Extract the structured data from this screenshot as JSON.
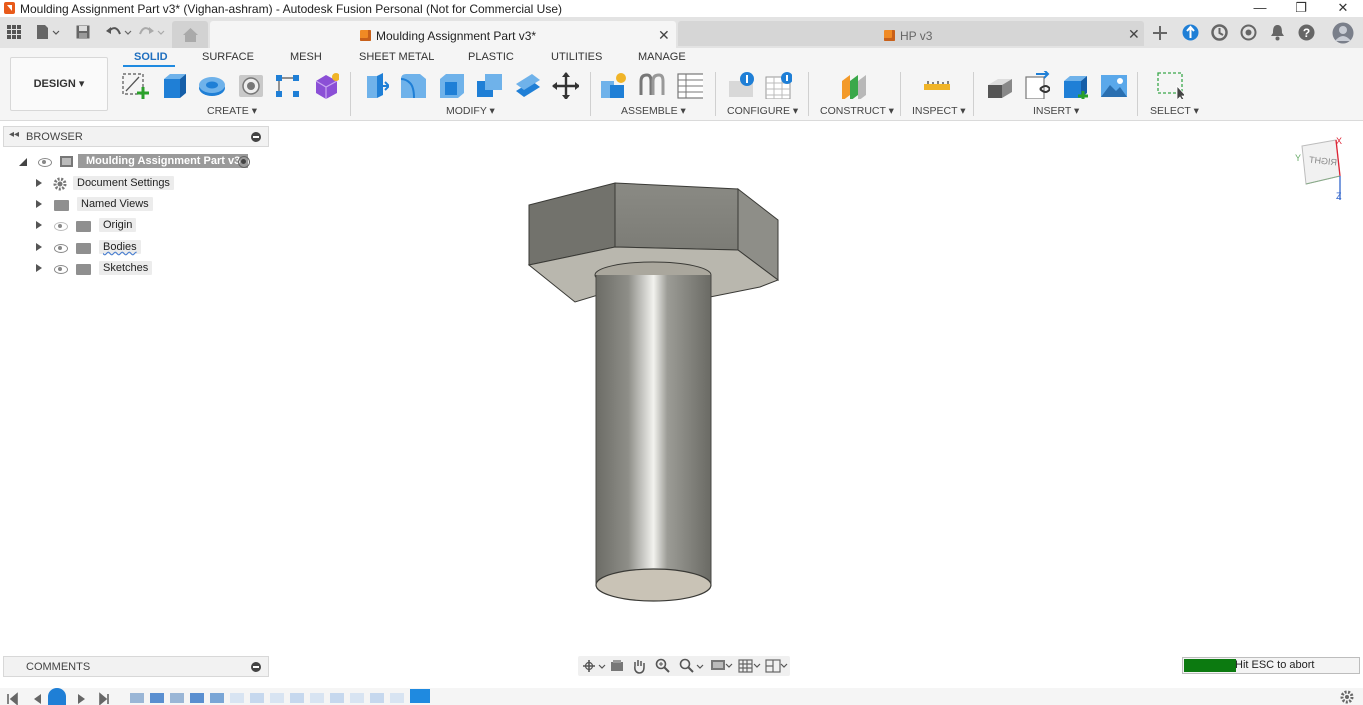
{
  "window": {
    "title": "Moulding Assignment Part v3* (Vighan-ashram) - Autodesk Fusion Personal (Not for Commercial Use)",
    "minimize_label": "—",
    "restore_label": "❐",
    "close_label": "✕"
  },
  "tabs": {
    "active": "Moulding Assignment Part v3*",
    "inactive": "HP v3",
    "close_glyph": "✕"
  },
  "toolbar": {
    "workspace": "DESIGN ▾",
    "ribbon_tabs": [
      "SOLID",
      "SURFACE",
      "MESH",
      "SHEET METAL",
      "PLASTIC",
      "UTILITIES",
      "MANAGE"
    ],
    "groups": {
      "create": "CREATE ▾",
      "modify": "MODIFY ▾",
      "assemble": "ASSEMBLE ▾",
      "configure": "CONFIGURE ▾",
      "construct": "CONSTRUCT ▾",
      "inspect": "INSPECT ▾",
      "insert": "INSERT ▾",
      "select": "SELECT ▾"
    }
  },
  "browser": {
    "title": "BROWSER",
    "root": "Moulding Assignment Part v3",
    "items": [
      "Document Settings",
      "Named Views",
      "Origin",
      "Bodies",
      "Sketches"
    ]
  },
  "viewcube": {
    "face": "RIGHT",
    "axis_x": "X",
    "axis_y": "Y",
    "axis_z": "Z"
  },
  "comments": {
    "title": "COMMENTS"
  },
  "status": {
    "abort_text": "Hit ESC to abort",
    "progress": 0.3
  },
  "colors": {
    "accent": "#1f8ae0",
    "progress": "#0c7a10",
    "model_face": "#8a8a84"
  }
}
